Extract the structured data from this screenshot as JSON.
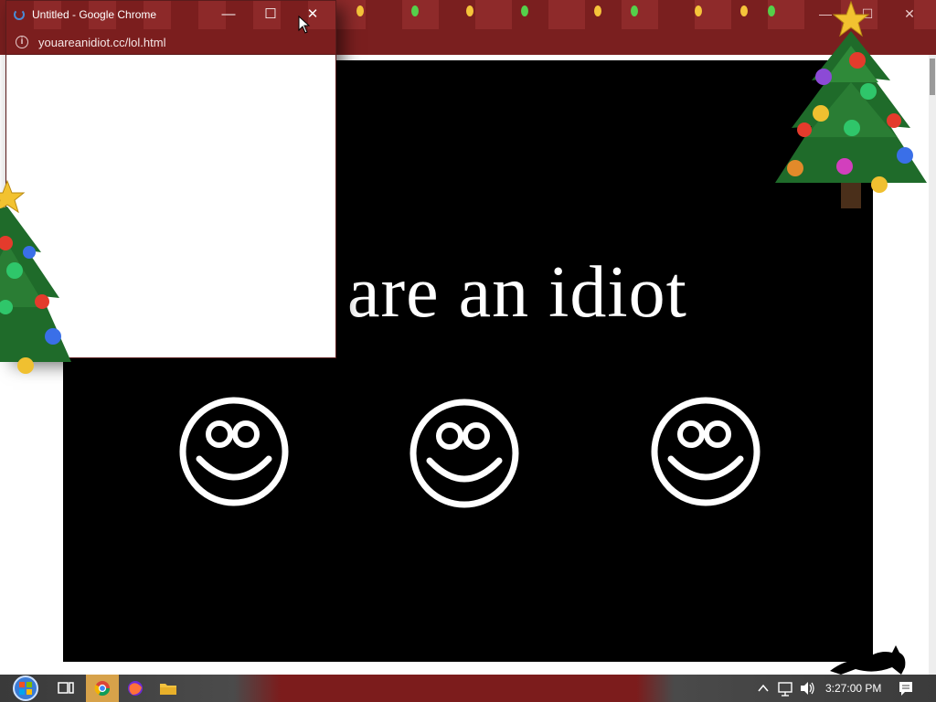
{
  "background_window": {
    "controls": {
      "minimize": "—",
      "maximize": "☐",
      "close": "✕"
    }
  },
  "mini_window": {
    "title": "Untitled - Google Chrome",
    "url": "youareanidiot.cc/lol.html",
    "controls": {
      "minimize": "—",
      "maximize": "☐",
      "close": "✕"
    }
  },
  "page": {
    "headline": "are an idiot",
    "smiley_count": 3
  },
  "taskbar": {
    "items": [
      {
        "name": "start-orb-icon"
      },
      {
        "name": "task-view-icon"
      },
      {
        "name": "chrome-icon",
        "active": true
      },
      {
        "name": "firefox-icon"
      },
      {
        "name": "file-explorer-icon"
      }
    ],
    "tray": {
      "time": "3:27:00 PM"
    }
  },
  "colors": {
    "chrome_red": "#7b1e1e",
    "panel_black": "#000000",
    "text_white": "#ffffff",
    "taskbar_active": "#d7a24a"
  }
}
